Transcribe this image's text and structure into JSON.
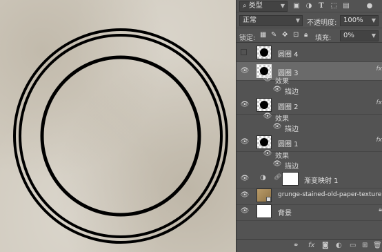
{
  "panel": {
    "filter": {
      "label": "类型",
      "icon": "search-icon"
    },
    "blend_mode": "正常",
    "opacity": {
      "label": "不透明度:",
      "value": "100%"
    },
    "lock": {
      "label": "锁定:"
    },
    "fill": {
      "label": "填充:",
      "value": "0%"
    },
    "effects_label": "效果",
    "stroke_label": "描边",
    "layers": [
      {
        "name": "圆圈 4",
        "visible": false,
        "selected": false
      },
      {
        "name": "圆圈 3",
        "visible": true,
        "selected": true
      },
      {
        "name": "圆圈 2",
        "visible": true,
        "selected": false
      },
      {
        "name": "圆圈 1",
        "visible": true,
        "selected": false
      },
      {
        "name": "渐变映射 1",
        "visible": true,
        "selected": false
      },
      {
        "name": "grunge-stained-old-paper-texture",
        "visible": true,
        "selected": false
      },
      {
        "name": "背景",
        "visible": true,
        "selected": false
      }
    ],
    "fx_text": "fx",
    "colors": {
      "panel_bg": "#535353",
      "selected_bg": "#6a6a6a",
      "canvas_bg": "#d2ccc0",
      "stroke": "#000000"
    }
  }
}
